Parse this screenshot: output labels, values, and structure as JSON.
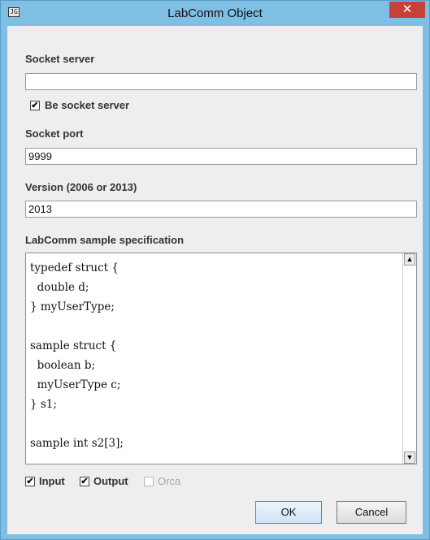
{
  "window": {
    "title": "LabComm Object",
    "app_icon": "JG",
    "close_glyph": "✕"
  },
  "socket_server": {
    "label": "Socket server",
    "value": ""
  },
  "be_socket_server": {
    "label": "Be socket server",
    "checked": true,
    "check_glyph": "✔"
  },
  "socket_port": {
    "label": "Socket port",
    "value": "9999"
  },
  "version": {
    "label": "Version (2006 or 2013)",
    "value": "2013"
  },
  "spec": {
    "label": "LabComm sample specification",
    "code": "typedef struct {\n  double d;\n} myUserType;\n\nsample struct {\n  boolean b;\n  myUserType c;\n} s1;\n\nsample int s2[3];",
    "scroll_up": "▲",
    "scroll_down": "▼"
  },
  "options": {
    "input": {
      "label": "Input",
      "checked": true,
      "check_glyph": "✔"
    },
    "output": {
      "label": "Output",
      "checked": true,
      "check_glyph": "✔"
    },
    "orca": {
      "label": "Orca",
      "checked": false,
      "enabled": false
    }
  },
  "buttons": {
    "ok": "OK",
    "cancel": "Cancel"
  }
}
